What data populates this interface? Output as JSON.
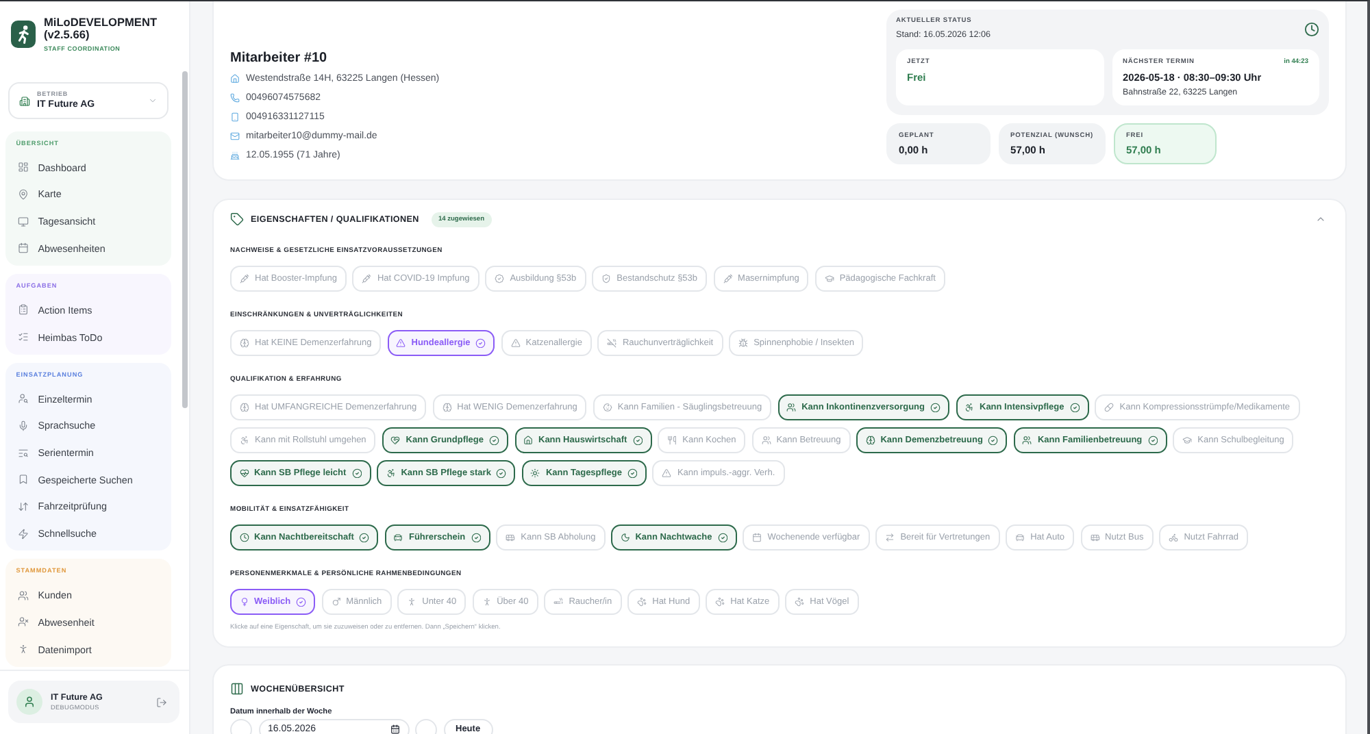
{
  "sidebar": {
    "app_title": "MiLoDEVELOPMENT (v2.5.66)",
    "app_subtitle": "STAFF COORDINATION",
    "company_select": {
      "label": "BETRIEB",
      "value": "IT Future AG"
    },
    "groups": [
      {
        "title": "ÜBERSICHT",
        "color": "#4f9d6c",
        "items": [
          {
            "label": "Dashboard",
            "selected": false
          },
          {
            "label": "Karte",
            "selected": false
          },
          {
            "label": "Tagesansicht",
            "selected": false
          },
          {
            "label": "Abwesenheiten",
            "selected": false
          }
        ]
      },
      {
        "title": "AUFGABEN",
        "color": "#8b6fe6",
        "items": [
          {
            "label": "Action Items",
            "selected": false
          },
          {
            "label": "Heimbas ToDo",
            "selected": false
          }
        ]
      },
      {
        "title": "EINSATZPLANUNG",
        "color": "#5b80de",
        "items": [
          {
            "label": "Einzeltermin",
            "selected": false
          },
          {
            "label": "Sprachsuche",
            "selected": false
          },
          {
            "label": "Serientermin",
            "selected": false
          },
          {
            "label": "Gespeicherte Suchen",
            "selected": false
          },
          {
            "label": "Fahrzeitprüfung",
            "selected": false
          },
          {
            "label": "Schnellsuche",
            "selected": false
          }
        ]
      },
      {
        "title": "STAMMDATEN",
        "color": "#e0983c",
        "items": [
          {
            "label": "Kunden",
            "selected": false
          },
          {
            "label": "Abwesenheit",
            "selected": false
          },
          {
            "label": "Datenimport",
            "selected": false
          }
        ]
      }
    ],
    "user": {
      "name": "IT Future AG",
      "mode": "DEBUGMODUS"
    }
  },
  "employee": {
    "name": "Mitarbeiter #10",
    "details": [
      {
        "kind": "address",
        "text": "Westendstraße 14H, 63225 Langen (Hessen)"
      },
      {
        "kind": "phone",
        "text": "00496074575682"
      },
      {
        "kind": "mobile",
        "text": "004916331127115"
      },
      {
        "kind": "email",
        "text": "mitarbeiter10@dummy-mail.de"
      },
      {
        "kind": "birthday",
        "text": "12.05.1955 (71 Jahre)"
      }
    ]
  },
  "status": {
    "title": "AKTUELLER STATUS",
    "stand": "Stand: 16.05.2026 12:06",
    "now": {
      "label": "JETZT",
      "value": "Frei"
    },
    "next": {
      "label": "NÄCHSTER TERMIN",
      "countdown": "in 44:23",
      "time": "2026-05-18 · 08:30–09:30 Uhr",
      "place": "Bahnstraße 22, 63225 Langen"
    }
  },
  "hours": [
    {
      "label": "GEPLANT",
      "value": "0,00 h",
      "highlighted": false
    },
    {
      "label": "POTENZIAL (WUNSCH)",
      "value": "57,00 h",
      "highlighted": false
    },
    {
      "label": "FREI",
      "value": "57,00 h",
      "highlighted": true
    }
  ],
  "qualifications": {
    "title": "EIGENSCHAFTEN / QUALIFIKATIONEN",
    "badge": "14 zugewiesen",
    "expanded": true,
    "sections": [
      {
        "title": "NACHWEISE & GESETZLICHE EINSATZVORAUSSETZUNGEN",
        "chips": [
          {
            "label": "Hat Booster-Impfung",
            "selected": false
          },
          {
            "label": "Hat COVID-19 Impfung",
            "selected": false
          },
          {
            "label": "Ausbildung §53b",
            "selected": false
          },
          {
            "label": "Bestandschutz §53b",
            "selected": false
          },
          {
            "label": "Masernimpfung",
            "selected": false
          },
          {
            "label": "Pädagogische Fachkraft",
            "selected": false
          }
        ]
      },
      {
        "title": "EINSCHRÄNKUNGEN & UNVERTRÄGLICHKEITEN",
        "chips": [
          {
            "label": "Hat KEINE Demenzerfahrung",
            "selected": false
          },
          {
            "label": "Hundeallergie",
            "selected": true,
            "color": "#8b5cf6"
          },
          {
            "label": "Katzenallergie",
            "selected": false
          },
          {
            "label": "Rauchunverträglichkeit",
            "selected": false
          },
          {
            "label": "Spinnenphobie / Insekten",
            "selected": false
          }
        ]
      },
      {
        "title": "QUALIFIKATION & ERFAHRUNG",
        "chips": [
          {
            "label": "Hat UMFANGREICHE Demenzerfahrung",
            "selected": false
          },
          {
            "label": "Hat WENIG Demenzerfahrung",
            "selected": false
          },
          {
            "label": "Kann Familien - Säuglingsbetreuung",
            "selected": false
          },
          {
            "label": "Kann Inkontinenzversorgung",
            "selected": true,
            "color": "#2d6a4b"
          },
          {
            "label": "Kann Intensivpflege",
            "selected": true,
            "color": "#2d6a4b"
          },
          {
            "label": "Kann Kompressionsstrümpfe/Medikamente",
            "selected": false
          },
          {
            "label": "Kann mit Rollstuhl umgehen",
            "selected": false
          },
          {
            "label": "Kann Grundpflege",
            "selected": true,
            "color": "#2d6a4b"
          },
          {
            "label": "Kann Hauswirtschaft",
            "selected": true,
            "color": "#2d6a4b"
          },
          {
            "label": "Kann Kochen",
            "selected": false
          },
          {
            "label": "Kann Betreuung",
            "selected": false
          },
          {
            "label": "Kann Demenzbetreuung",
            "selected": true,
            "color": "#2d6a4b"
          },
          {
            "label": "Kann Familienbetreuung",
            "selected": true,
            "color": "#2d6a4b"
          },
          {
            "label": "Kann Schulbegleitung",
            "selected": false
          },
          {
            "label": "Kann SB Pflege leicht",
            "selected": true,
            "color": "#2d6a4b"
          },
          {
            "label": "Kann SB Pflege stark",
            "selected": true,
            "color": "#2d6a4b"
          },
          {
            "label": "Kann Tagespflege",
            "selected": true,
            "color": "#2d6a4b"
          },
          {
            "label": "Kann impuls.-aggr. Verh.",
            "selected": false
          }
        ]
      },
      {
        "title": "MOBILITÄT & EINSATZFÄHIGKEIT",
        "chips": [
          {
            "label": "Kann Nachtbereitschaft",
            "selected": true,
            "color": "#2d6a4b"
          },
          {
            "label": "Führerschein",
            "selected": true,
            "color": "#2d6a4b"
          },
          {
            "label": "Kann SB Abholung",
            "selected": false
          },
          {
            "label": "Kann Nachtwache",
            "selected": true,
            "color": "#2d6a4b"
          },
          {
            "label": "Wochenende verfügbar",
            "selected": false
          },
          {
            "label": "Bereit für Vertretungen",
            "selected": false
          },
          {
            "label": "Hat Auto",
            "selected": false
          },
          {
            "label": "Nutzt Bus",
            "selected": false
          },
          {
            "label": "Nutzt Fahrrad",
            "selected": false
          }
        ]
      },
      {
        "title": "PERSONENMERKMALE & PERSÖNLICHE RAHMENBEDINGUNGEN",
        "chips": [
          {
            "label": "Weiblich",
            "selected": true,
            "color": "#8b5cf6"
          },
          {
            "label": "Männlich",
            "selected": false
          },
          {
            "label": "Unter 40",
            "selected": false
          },
          {
            "label": "Über 40",
            "selected": false
          },
          {
            "label": "Raucher/in",
            "selected": false
          },
          {
            "label": "Hat Hund",
            "selected": false
          },
          {
            "label": "Hat Katze",
            "selected": false
          },
          {
            "label": "Hat Vögel",
            "selected": false
          }
        ]
      }
    ],
    "hint": "Klicke auf eine Eigenschaft, um sie zuzuweisen oder zu entfernen. Dann „Speichern“ klicken."
  },
  "week_overview": {
    "title": "WOCHENÜBERSICHT",
    "date_label": "Datum innerhalb der Woche",
    "date_value": "16.05.2026",
    "today_button": "Heute"
  }
}
